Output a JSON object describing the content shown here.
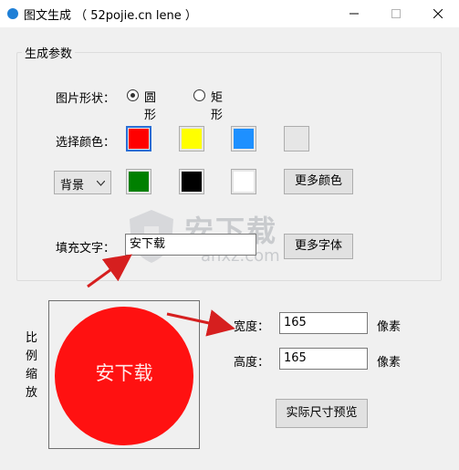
{
  "window": {
    "title": "图文生成 （ 52pojie.cn lene ）"
  },
  "group": {
    "title": "生成参数"
  },
  "shape": {
    "label": "图片形状：",
    "options": [
      {
        "label": "圆形",
        "selected": true
      },
      {
        "label": "矩形",
        "selected": false
      }
    ]
  },
  "colors": {
    "label": "选择颜色：",
    "row1": [
      "#ff0000",
      "#ffff00",
      "#1e90ff",
      "#e6e6e6"
    ],
    "row2": [
      "#008000",
      "#000000",
      "#ffffff"
    ],
    "selected": "#ff0000",
    "combo_value": "背景",
    "more_colors_label": "更多颜色"
  },
  "fill_text": {
    "label": "填充文字：",
    "value": "安下载",
    "more_fonts_label": "更多字体"
  },
  "scale_label": [
    "比",
    "例",
    "缩",
    "放"
  ],
  "preview": {
    "text": "安下载",
    "circle_color": "#ff1111"
  },
  "size": {
    "width_label": "宽度：",
    "width_value": "165",
    "height_label": "高度：",
    "height_value": "165",
    "unit": "像素"
  },
  "actual_preview_label": "实际尺寸预览",
  "watermark": {
    "cn": "安下载",
    "en": "anxz.com"
  }
}
